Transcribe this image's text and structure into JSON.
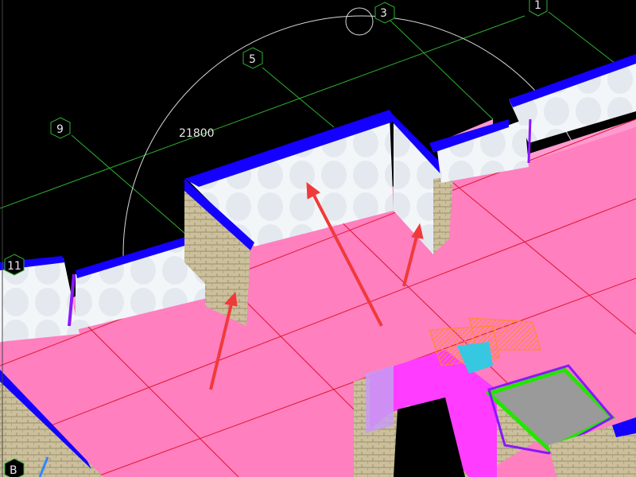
{
  "viewport": {
    "dimension_text": "21800",
    "colors": {
      "background": "#000000",
      "floor_slab": "#ff7fbf",
      "floor_edge": "#ff9ad1",
      "wall_face": "#f2f5f8",
      "wall_cap": "#1400ff",
      "brick": "#cbbf9c",
      "axis_line": "#2fb02f",
      "grid_red": "#e0152d",
      "arrow": "#f03a3a",
      "stair_orange": "#ff8a1e",
      "column_green": "#22e600",
      "column_fill": "#9a9a9a",
      "magenta": "#ff3cff",
      "violet": "#8a17ff"
    },
    "axis_bubbles": [
      {
        "label": "1"
      },
      {
        "label": "3"
      },
      {
        "label": "5"
      },
      {
        "label": "9"
      },
      {
        "label": "11"
      },
      {
        "label": "B"
      }
    ],
    "arrows": [
      {
        "name": "annotation-arrow-1"
      },
      {
        "name": "annotation-arrow-2"
      },
      {
        "name": "annotation-arrow-3"
      }
    ]
  }
}
